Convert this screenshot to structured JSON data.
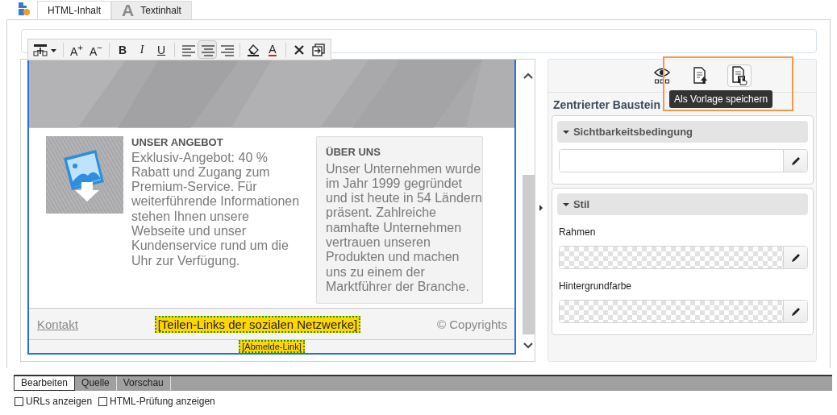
{
  "tabs": [
    {
      "label": "HTML-Inhalt",
      "kind": "html",
      "selected": true
    },
    {
      "label": "Textinhalt",
      "kind": "text",
      "glyph": "A",
      "selected": false
    }
  ],
  "toolbar": [
    {
      "kind": "block-insert",
      "selected": false
    },
    {
      "kind": "grow",
      "label": "A$^{+}$",
      "selected": false
    },
    {
      "kind": "shrink",
      "label": "A$^{−}$",
      "selected": false
    },
    {
      "kind": "bold",
      "label": "B",
      "selected": false
    },
    {
      "kind": "italic",
      "label": "I",
      "selected": false
    },
    {
      "kind": "underline",
      "label": "U",
      "selected": false
    },
    {
      "kind": "align-left",
      "selected": false
    },
    {
      "kind": "align-center",
      "selected": true
    },
    {
      "kind": "align-right",
      "selected": false
    },
    {
      "kind": "fill-color",
      "selected": false
    },
    {
      "kind": "font-color",
      "label": "A",
      "selected": false
    },
    {
      "kind": "remove",
      "selected": false
    },
    {
      "kind": "import",
      "selected": false
    }
  ],
  "content": {
    "offer": {
      "title": "UNSER ANGEBOT",
      "text": "Exklusiv-Angebot: 40 % Rabatt und Zugang zum Premium-Service. Für weiterführende Informationen stehen Ihnen unsere Webseite und unser Kundenservice rund um die Uhr zur Verfügung."
    },
    "about": {
      "title": "ÜBER UNS",
      "text": "Unser Unternehmen wurde im Jahr 1999 gegründet und ist heute in 54 Ländern präsent. Zahlreiche namhafte Unternehmen vertrauen unseren Produkten und machen uns zu einem der Marktführer der Branche."
    },
    "footer": {
      "link": "Kontakt",
      "social": "[Teilen-Links der sozialen Netzwerke]",
      "copyright": "© Copyrights"
    },
    "unsubscribe": "[Abmelde-Link]"
  },
  "panel": {
    "tools": [
      {
        "kind": "preview",
        "hovered": false
      },
      {
        "kind": "upload",
        "hovered": false
      },
      {
        "kind": "save",
        "hovered": true
      }
    ],
    "tooltip": "Als Vorlage speichern",
    "title": "Zentrierter Baustein",
    "sections": [
      {
        "title": "Sichtbarkeitsbedingung",
        "expanded": true,
        "fields": [
          {
            "kind": "text"
          }
        ]
      },
      {
        "title": "Stil",
        "expanded": true,
        "fields": [
          {
            "kind": "color",
            "label": "Rahmen"
          },
          {
            "kind": "color",
            "label": "Hintergrundfarbe"
          }
        ]
      }
    ]
  },
  "bottom_tabs": [
    {
      "label": "Bearbeiten",
      "selected": true
    },
    {
      "label": "Quelle",
      "selected": false
    },
    {
      "label": "Vorschau",
      "selected": false
    }
  ],
  "options": [
    {
      "label": "URLs anzeigen",
      "checked": false
    },
    {
      "label": "HTML-Prüfung anzeigen",
      "checked": false
    }
  ]
}
